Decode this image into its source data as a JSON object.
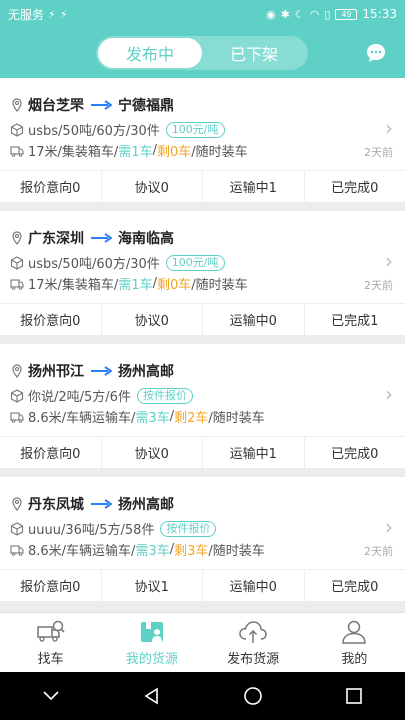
{
  "status_bar": {
    "carrier": "无服务",
    "battery": "49",
    "time": "15:33"
  },
  "header": {
    "tabs": [
      {
        "label": "发布中",
        "active": true
      },
      {
        "label": "已下架",
        "active": false
      }
    ],
    "chat_icon": "chat-bubble-icon"
  },
  "colors": {
    "accent": "#5fd0c6",
    "highlight": "#f5a623"
  },
  "cards": [
    {
      "origin": "烟台芝罘",
      "destination": "宁德福鼎",
      "goods": "usbs/50吨/60方/30件",
      "price": "100元/吨",
      "vehicle": "17米/集装箱车/",
      "need": "需1车",
      "remain": "剩0车",
      "loading": "/随时装车",
      "time": "2天前",
      "stats": [
        "报价意向0",
        "协议0",
        "运输中1",
        "已完成0"
      ]
    },
    {
      "origin": "广东深圳",
      "destination": "海南临高",
      "goods": "usbs/50吨/60方/30件",
      "price": "100元/吨",
      "vehicle": "17米/集装箱车/",
      "need": "需1车",
      "remain": "剩0车",
      "loading": "/随时装车",
      "time": "2天前",
      "stats": [
        "报价意向0",
        "协议0",
        "运输中0",
        "已完成1"
      ]
    },
    {
      "origin": "扬州邗江",
      "destination": "扬州高邮",
      "goods": "你说/2吨/5方/6件",
      "price": "按件报价",
      "vehicle": "8.6米/车辆运输车/",
      "need": "需3车",
      "remain": "剩2车",
      "loading": "/随时装车",
      "time": "",
      "stats": [
        "报价意向0",
        "协议0",
        "运输中1",
        "已完成0"
      ]
    },
    {
      "origin": "丹东凤城",
      "destination": "扬州高邮",
      "goods": "uuuu/36吨/5方/58件",
      "price": "按件报价",
      "vehicle": "8.6米/车辆运输车/",
      "need": "需3车",
      "remain": "剩3车",
      "loading": "/随时装车",
      "time": "2天前",
      "stats": [
        "报价意向0",
        "协议1",
        "运输中0",
        "已完成0"
      ]
    }
  ],
  "tabbar": [
    {
      "label": "找车",
      "icon": "truck-search-icon",
      "active": false
    },
    {
      "label": "我的货源",
      "icon": "cargo-icon",
      "active": true
    },
    {
      "label": "发布货源",
      "icon": "cloud-upload-icon",
      "active": false
    },
    {
      "label": "我的",
      "icon": "user-icon",
      "active": false
    }
  ],
  "navbar": [
    "back-icon",
    "home-icon",
    "recents-icon"
  ]
}
